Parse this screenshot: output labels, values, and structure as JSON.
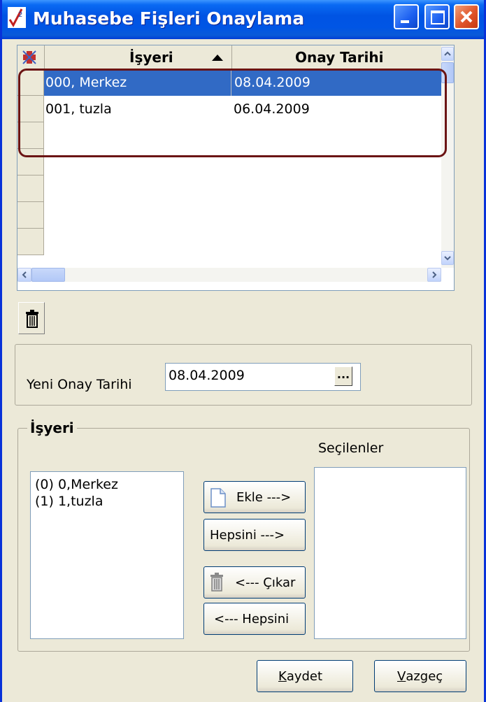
{
  "window": {
    "title": "Muhasebe Fişleri Onaylama"
  },
  "grid": {
    "columns": [
      {
        "label": "İşyeri",
        "sort": "ascending"
      },
      {
        "label": "Onay Tarihi"
      }
    ],
    "rows": [
      {
        "isyeri": "000, Merkez",
        "onay_tarihi": "08.04.2009",
        "selected": true
      },
      {
        "isyeri": "001, tuzla",
        "onay_tarihi": "06.04.2009",
        "selected": false
      }
    ]
  },
  "form": {
    "yeni_onay_label": "Yeni Onay Tarihi",
    "yeni_onay_value": "08.04.2009",
    "dots_label": "..."
  },
  "isyeri_group": {
    "legend": "İşyeri",
    "secilenler_label": "Seçilenler",
    "available": [
      "(0) 0,Merkez",
      "(1) 1,tuzla"
    ],
    "selected": []
  },
  "buttons": {
    "ekle": "Ekle --->",
    "hepsini_right": "Hepsini --->",
    "cikar": "<--- Çıkar",
    "hepsini_left": "<--- Hepsini",
    "kaydet_hotkey": "K",
    "kaydet_rest": "aydet",
    "vazgec_hotkey": "V",
    "vazgec_rest": "azgeç"
  },
  "colors": {
    "titlebar": "#0054e3",
    "selection": "#316ac5",
    "highlight_ring": "#6b1414"
  }
}
